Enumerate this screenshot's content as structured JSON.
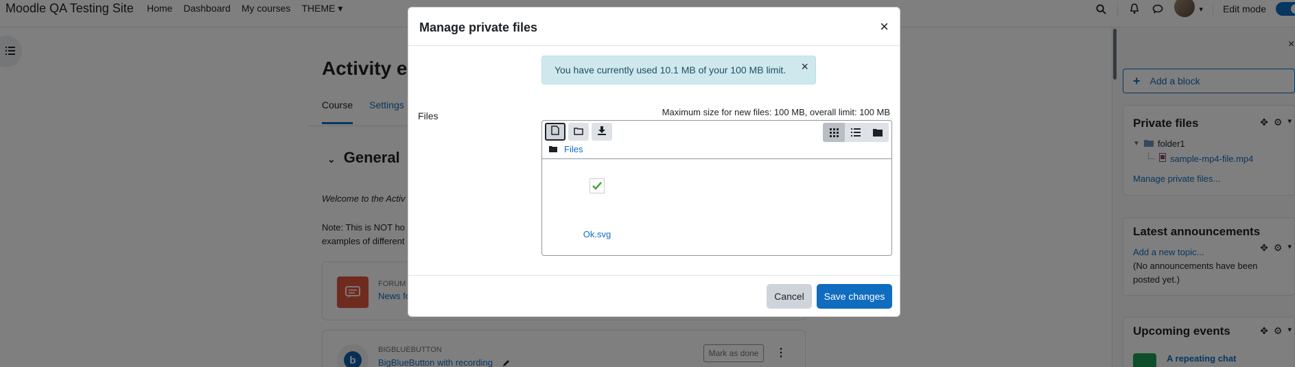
{
  "navbar": {
    "site_name": "Moodle QA Testing Site",
    "items": [
      {
        "label": "Home"
      },
      {
        "label": "Dashboard"
      },
      {
        "label": "My courses"
      },
      {
        "label": "THEME"
      }
    ],
    "edit_mode_label": "Edit mode"
  },
  "page": {
    "heading": "Activity ex",
    "tabs": [
      {
        "label": "Course"
      },
      {
        "label": "Settings"
      }
    ],
    "section_title": "General",
    "welcome_text": "Welcome to the Activ",
    "note_line1": "Note: This is NOT ho",
    "note_line2": "examples of different",
    "activities": [
      {
        "type": "FORUM",
        "name": "News fo"
      },
      {
        "type": "BIGBLUEBUTTON",
        "name": "BigBlueButton with recording",
        "mark_done": "Mark as done"
      }
    ]
  },
  "drawer": {
    "add_block": "Add a block",
    "private_files": {
      "title": "Private files",
      "folder": "folder1",
      "file": "sample-mp4-file.mp4",
      "manage_link": "Manage private files..."
    },
    "announcements": {
      "title": "Latest announcements",
      "add_link": "Add a new topic...",
      "empty": "(No announcements have been posted yet.)"
    },
    "upcoming": {
      "title": "Upcoming events",
      "event": "A repeating chat"
    }
  },
  "modal": {
    "title": "Manage private files",
    "alert": "You have currently used 10.1 MB of your 100 MB limit.",
    "files_label": "Files",
    "max_size": "Maximum size for new files: 100 MB, overall limit: 100 MB",
    "breadcrumb": "Files",
    "file_name": "Ok.svg",
    "cancel": "Cancel",
    "save": "Save changes"
  },
  "colors": {
    "primary": "#0f6cbf",
    "alert_bg": "#cfe8ee",
    "forum_icon": "#e1573e",
    "bbb_icon": "#0f5fa8"
  }
}
